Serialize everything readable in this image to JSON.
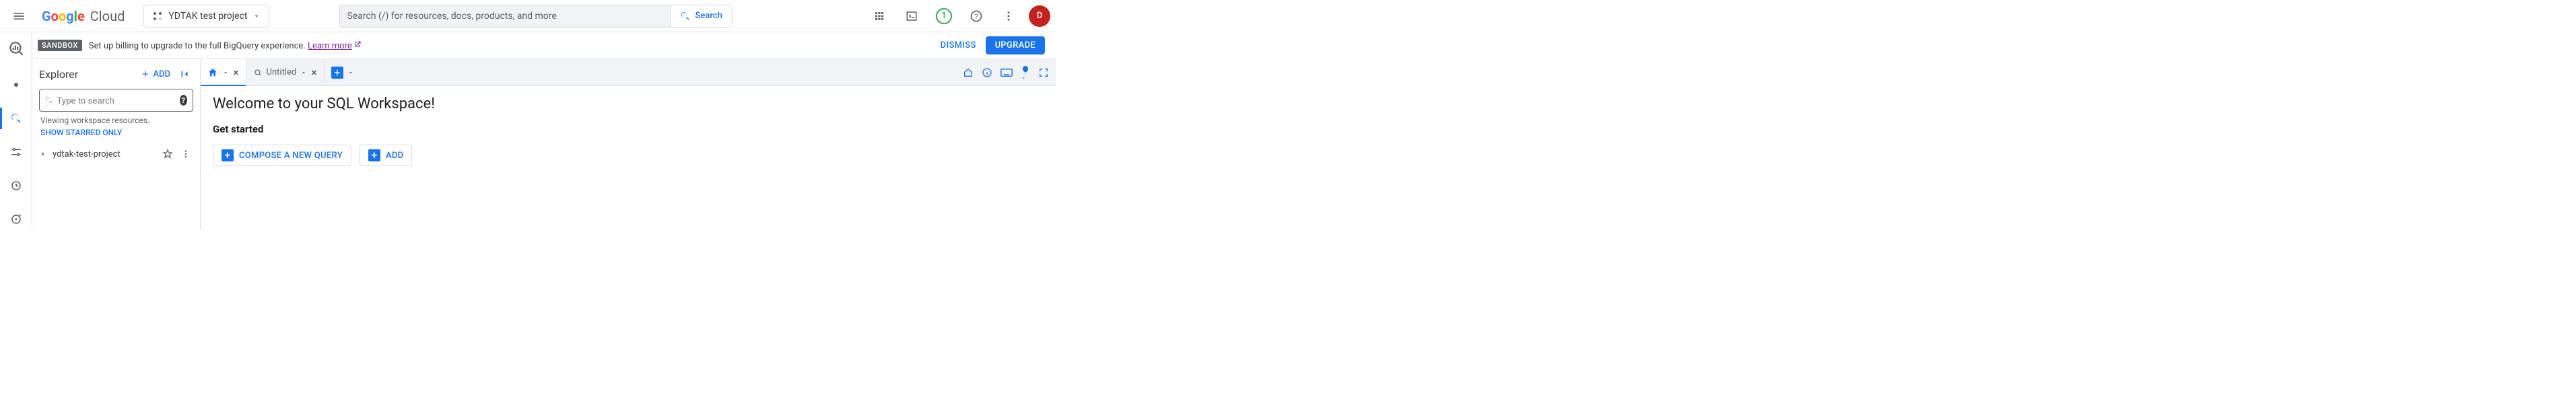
{
  "header": {
    "logo_cloud": "Cloud",
    "project_name": "YDTAK test project",
    "search_placeholder": "Search (/) for resources, docs, products, and more",
    "search_button": "Search",
    "notif_count": "1",
    "avatar_letter": "D"
  },
  "banner": {
    "chip": "SANDBOX",
    "text": "Set up billing to upgrade to the full BigQuery experience. ",
    "link": "Learn more",
    "dismiss": "DISMISS",
    "upgrade": "UPGRADE"
  },
  "explorer": {
    "title": "Explorer",
    "add": "ADD",
    "search_placeholder": "Type to search",
    "viewing_note": "Viewing workspace resources.",
    "starred_link": "SHOW STARRED ONLY",
    "tree": {
      "project": "ydtak-test-project"
    }
  },
  "tabs": {
    "untitled": "Untitled"
  },
  "workspace": {
    "welcome": "Welcome to your SQL Workspace!",
    "get_started": "Get started",
    "compose": "COMPOSE A NEW QUERY",
    "add": "ADD"
  }
}
